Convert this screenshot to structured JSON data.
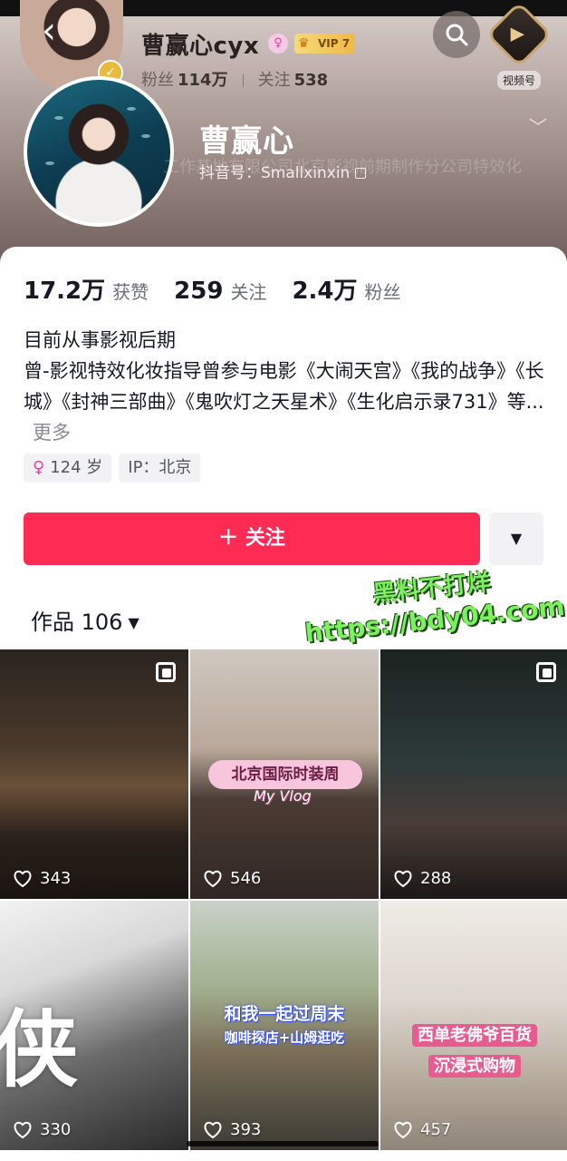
{
  "header": {
    "mini_name": "曹赢心cyx",
    "vip_level": "VIP 7",
    "fans_label": "粉丝",
    "fans_value": "114万",
    "following_label": "关注",
    "following_value": "538",
    "channel_label": "视频号",
    "display_name": "曹赢心",
    "douyin_id": "抖音号：Smallxinxin",
    "ghost_text": "工作基地有限公司北京影视前期制作分公司特效化"
  },
  "stats": [
    {
      "value": "17.2万",
      "label": "获赞"
    },
    {
      "value": "259",
      "label": "关注"
    },
    {
      "value": "2.4万",
      "label": "粉丝"
    }
  ],
  "bio": {
    "line1": "目前从事影视后期",
    "line2": "曾-影视特效化妆指导曾参与电影《大闹天宫》《我的战争》《长城》《封神三部曲》《鬼吹灯之天星术》《生化启示录731》等...",
    "more": "更多"
  },
  "tags": {
    "age": "124 岁",
    "ip": "IP：北京"
  },
  "buttons": {
    "follow": "＋ 关注",
    "more": "▼"
  },
  "works": {
    "label": "作品 106"
  },
  "watermark": {
    "line1": "黑料不打烊",
    "line2": "https://bdy04.com"
  },
  "grid": [
    {
      "likes": "343",
      "multi": true
    },
    {
      "likes": "546",
      "multi": false,
      "title": "北京国际时装周",
      "subtitle": "My Vlog"
    },
    {
      "likes": "288",
      "multi": true
    },
    {
      "likes": "330",
      "multi": false,
      "big_char": "侠"
    },
    {
      "likes": "393",
      "multi": false,
      "title": "和我一起过周末",
      "subtitle": "咖啡探店+山姆逛吃"
    },
    {
      "likes": "457",
      "multi": false,
      "title": "西单老佛爷百货",
      "subtitle": "沉浸式购物"
    }
  ],
  "colors": {
    "accent": "#fe2c55",
    "watermark": "#7ef060"
  },
  "icons": [
    "back-icon",
    "search-icon",
    "channel-icon",
    "female-icon",
    "crown-icon",
    "copy-icon",
    "chevron-down-icon",
    "heart-icon",
    "multi-image-icon"
  ]
}
